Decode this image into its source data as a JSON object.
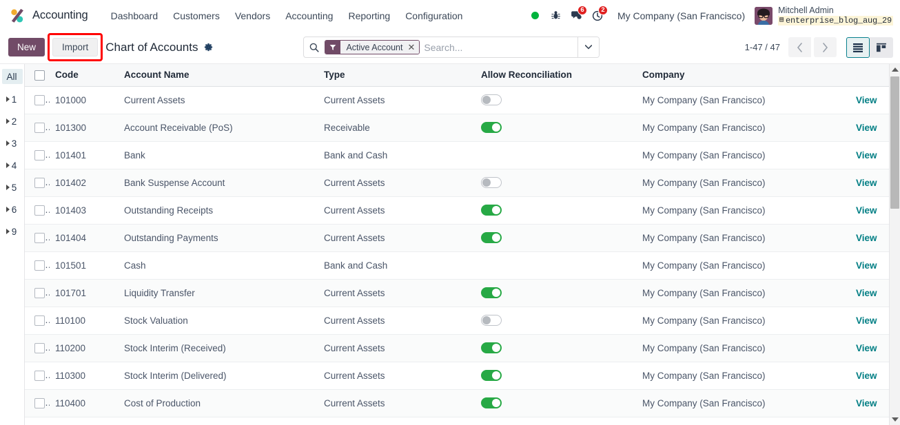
{
  "navbar": {
    "brand": "Accounting",
    "logo_icon": "odoo-accounting-logo",
    "menu": [
      {
        "label": "Dashboard",
        "name": "menu-dashboard"
      },
      {
        "label": "Customers",
        "name": "menu-customers"
      },
      {
        "label": "Vendors",
        "name": "menu-vendors"
      },
      {
        "label": "Accounting",
        "name": "menu-accounting"
      },
      {
        "label": "Reporting",
        "name": "menu-reporting"
      },
      {
        "label": "Configuration",
        "name": "menu-configuration"
      }
    ],
    "status_dot_color": "#00b33c",
    "debug_icon": "bug-icon",
    "messages_icon": "chat-bubble-icon",
    "messages_count": "6",
    "activities_icon": "clock-icon",
    "activities_count": "2",
    "company": "My Company (San Francisco)",
    "user_name": "Mitchell Admin",
    "database": "enterprise_blog_aug_29",
    "database_icon": "database-icon",
    "avatar_icon": "user-avatar"
  },
  "control_panel": {
    "new_label": "New",
    "import_label": "Import",
    "import_highlighted": true,
    "title": "Chart of Accounts",
    "settings_icon": "gear-icon",
    "search": {
      "search_icon": "search-icon",
      "facet_icon": "filter-funnel-icon",
      "facet_label": "Active Account",
      "facet_close_icon": "close-icon",
      "placeholder": "Search...",
      "value": "",
      "toggle_icon": "chevron-down-icon"
    },
    "pager": {
      "count": "1-47 / 47",
      "prev_icon": "chevron-left-icon",
      "next_icon": "chevron-right-icon"
    },
    "views": [
      {
        "name": "view-list",
        "icon": "list-view-icon",
        "active": true
      },
      {
        "name": "view-kanban",
        "icon": "kanban-view-icon",
        "active": false
      }
    ]
  },
  "sidebar": {
    "items": [
      {
        "label": "All",
        "active": true,
        "expandable": false
      },
      {
        "label": "1",
        "active": false,
        "expandable": true
      },
      {
        "label": "2",
        "active": false,
        "expandable": true
      },
      {
        "label": "3",
        "active": false,
        "expandable": true
      },
      {
        "label": "4",
        "active": false,
        "expandable": true
      },
      {
        "label": "5",
        "active": false,
        "expandable": true
      },
      {
        "label": "6",
        "active": false,
        "expandable": true
      },
      {
        "label": "9",
        "active": false,
        "expandable": true
      }
    ]
  },
  "table": {
    "columns": [
      {
        "label": "Code",
        "name": "column-code"
      },
      {
        "label": "Account Name",
        "name": "column-account-name"
      },
      {
        "label": "Type",
        "name": "column-type"
      },
      {
        "label": "Allow Reconciliation",
        "name": "column-allow-reconciliation"
      },
      {
        "label": "Company",
        "name": "column-company"
      }
    ],
    "optional_columns_icon": "column-settings-icon",
    "view_label": "View",
    "rows": [
      {
        "code": "101000",
        "name": "Current Assets",
        "type": "Current Assets",
        "reconcile": "off",
        "company": "My Company (San Francisco)",
        "action": "View"
      },
      {
        "code": "101300",
        "name": "Account Receivable (PoS)",
        "type": "Receivable",
        "reconcile": "on",
        "company": "My Company (San Francisco)",
        "action": "View"
      },
      {
        "code": "101401",
        "name": "Bank",
        "type": "Bank and Cash",
        "reconcile": "none",
        "company": "My Company (San Francisco)",
        "action": "View"
      },
      {
        "code": "101402",
        "name": "Bank Suspense Account",
        "type": "Current Assets",
        "reconcile": "off",
        "company": "My Company (San Francisco)",
        "action": "View"
      },
      {
        "code": "101403",
        "name": "Outstanding Receipts",
        "type": "Current Assets",
        "reconcile": "on",
        "company": "My Company (San Francisco)",
        "action": "View"
      },
      {
        "code": "101404",
        "name": "Outstanding Payments",
        "type": "Current Assets",
        "reconcile": "on",
        "company": "My Company (San Francisco)",
        "action": "View"
      },
      {
        "code": "101501",
        "name": "Cash",
        "type": "Bank and Cash",
        "reconcile": "none",
        "company": "My Company (San Francisco)",
        "action": "View"
      },
      {
        "code": "101701",
        "name": "Liquidity Transfer",
        "type": "Current Assets",
        "reconcile": "on",
        "company": "My Company (San Francisco)",
        "action": "View"
      },
      {
        "code": "110100",
        "name": "Stock Valuation",
        "type": "Current Assets",
        "reconcile": "off",
        "company": "My Company (San Francisco)",
        "action": "View"
      },
      {
        "code": "110200",
        "name": "Stock Interim (Received)",
        "type": "Current Assets",
        "reconcile": "on",
        "company": "My Company (San Francisco)",
        "action": "View"
      },
      {
        "code": "110300",
        "name": "Stock Interim (Delivered)",
        "type": "Current Assets",
        "reconcile": "on",
        "company": "My Company (San Francisco)",
        "action": "View"
      },
      {
        "code": "110400",
        "name": "Cost of Production",
        "type": "Current Assets",
        "reconcile": "on",
        "company": "My Company (San Francisco)",
        "action": "View"
      }
    ]
  },
  "colors": {
    "brand_purple": "#714B67",
    "toggle_on_green": "#27a945",
    "link_teal": "#017e84",
    "highlight_red": "#ff0000",
    "status_green": "#00b33c",
    "badge_red": "#e02020"
  }
}
